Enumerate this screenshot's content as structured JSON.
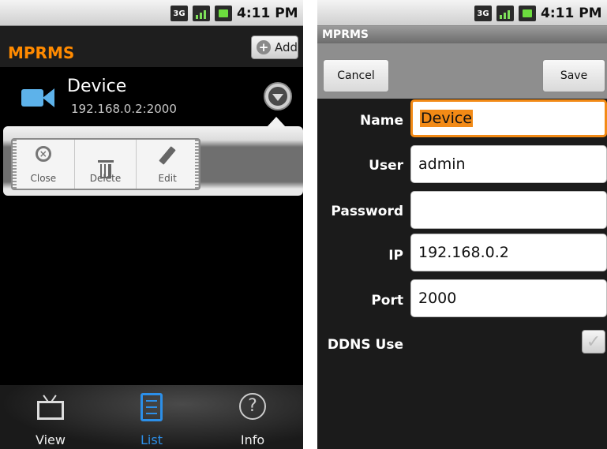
{
  "left": {
    "status": {
      "network": "3G",
      "time": "4:11 PM"
    },
    "app_title": "MPRMS",
    "add_label": "Add",
    "device": {
      "name": "Device",
      "address": "192.168.0.2:2000"
    },
    "quick_actions": [
      "Close",
      "Delete",
      "Edit"
    ],
    "nav": [
      {
        "label": "View",
        "icon": "tv-icon",
        "active": false
      },
      {
        "label": "List",
        "icon": "list-icon",
        "active": true
      },
      {
        "label": "Info",
        "icon": "info-icon",
        "active": false
      }
    ]
  },
  "right": {
    "status": {
      "network": "3G",
      "time": "4:11 PM"
    },
    "title": "MPRMS",
    "cancel_label": "Cancel",
    "save_label": "Save",
    "fields": {
      "name": {
        "label": "Name",
        "value": "Device"
      },
      "user": {
        "label": "User",
        "value": "admin"
      },
      "password": {
        "label": "Password",
        "value": ""
      },
      "ip": {
        "label": "IP",
        "value": "192.168.0.2"
      },
      "port": {
        "label": "Port",
        "value": "2000"
      }
    },
    "ddns": {
      "label": "DDNS Use",
      "checked": true
    }
  },
  "colors": {
    "accent_orange": "#ff8a00",
    "selection": "#f28a16",
    "active_tab": "#2c8fe8",
    "camera_blue": "#5db2ea"
  }
}
